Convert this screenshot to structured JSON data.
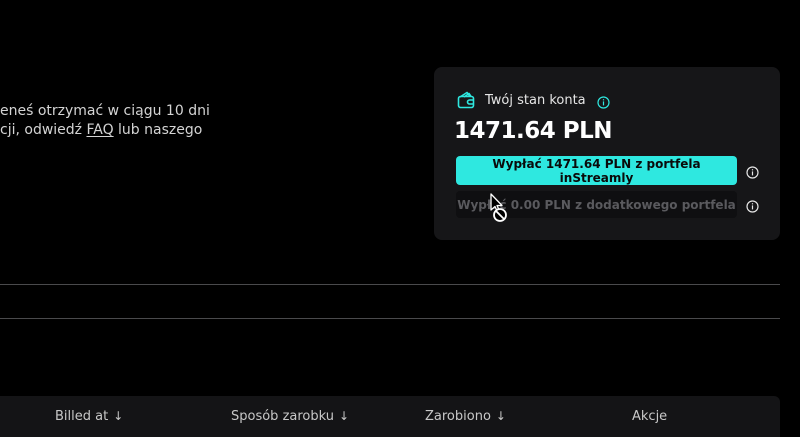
{
  "info": {
    "line1": "eneś otrzymać w ciągu 10 dni",
    "line2_prefix": "cji, odwiedź ",
    "faq_link": "FAQ",
    "line2_suffix": " lub naszego"
  },
  "balance_card": {
    "title": "Twój stan konta",
    "amount": "1471.64 PLN",
    "withdraw_label": "Wypłać 1471.64 PLN z portfela inStreamly",
    "withdraw_extra_label": "Wypłać 0.00 PLN z dodatkowego portfela"
  },
  "table": {
    "columns": [
      {
        "label": "Billed at",
        "sort": "↓"
      },
      {
        "label": "Sposób zarobku",
        "sort": "↓"
      },
      {
        "label": "Zarobiono",
        "sort": "↓"
      },
      {
        "label": "Akcje",
        "sort": ""
      }
    ]
  },
  "colors": {
    "accent": "#2ee8e0",
    "background": "#000000",
    "card": "#161618"
  },
  "icons": {
    "wallet": "wallet-icon",
    "info": "info-icon",
    "cursor": "not-allowed-cursor"
  }
}
